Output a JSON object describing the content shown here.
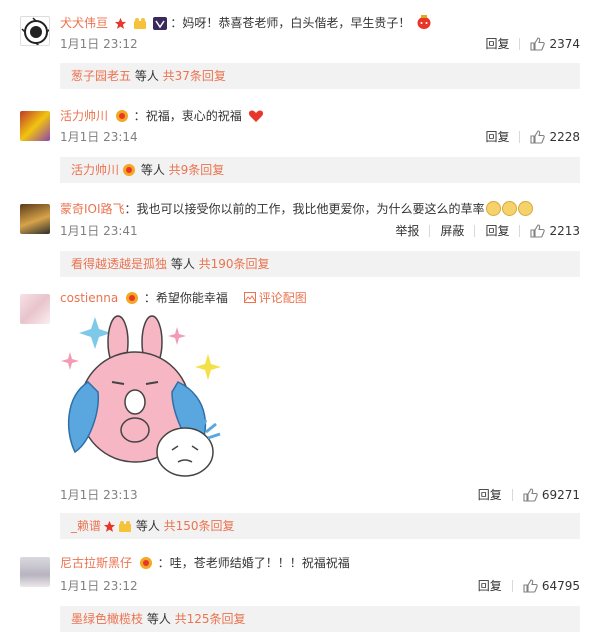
{
  "comments": [
    {
      "user": "犬犬伟亘",
      "text": "妈呀！恭喜苍老师，白头偕老，早生贵子！",
      "time": "1月1日 23:12",
      "reply_label": "回复",
      "likes": "2374",
      "sub": {
        "user": "葱子园老五",
        "middle": " 等人 ",
        "count": "共37条回复"
      }
    },
    {
      "user": "活力帅川",
      "text": "祝福，衷心的祝福",
      "time": "1月1日 23:14",
      "reply_label": "回复",
      "likes": "2228",
      "sub": {
        "user": "活力帅川",
        "middle": " 等人 ",
        "count": "共9条回复"
      }
    },
    {
      "user": "蒙奇IOI路飞",
      "text": "我也可以接受你以前的工作，我比他更爱你，为什么要这么的草率",
      "time": "1月1日 23:41",
      "report_label": "举报",
      "block_label": "屏蔽",
      "reply_label": "回复",
      "likes": "2213",
      "sub": {
        "user": "看得越透越是孤独",
        "middle": " 等人 ",
        "count": "共190条回复"
      }
    },
    {
      "user": "costienna",
      "text": "希望你能幸福",
      "pic_label": "评论配图",
      "time": "1月1日 23:13",
      "reply_label": "回复",
      "likes": "69271",
      "sub": {
        "user": "_赖谱",
        "middle": " 等人 ",
        "count": "共150条回复"
      }
    },
    {
      "user": "尼古拉斯黑仔",
      "text": "哇，苍老师结婚了！！！祝福祝福",
      "time": "1月1日 23:12",
      "reply_label": "回复",
      "likes": "64795",
      "sub": {
        "user": "墨绿色橄榄枝",
        "middle": " 等人 ",
        "count": "共125条回复"
      }
    }
  ],
  "colors": {
    "username": "#eb7350",
    "subbox_bg": "#f2f2f2",
    "meta_text": "#808080"
  },
  "icons": [
    "like-icon",
    "vip-badge-icon",
    "picture-icon",
    "heart-emoji-icon",
    "confused-emoji-icon"
  ]
}
